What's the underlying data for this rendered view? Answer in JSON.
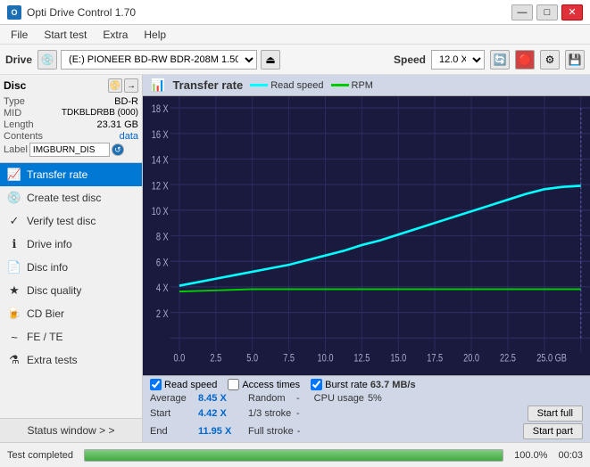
{
  "titleBar": {
    "title": "Opti Drive Control 1.70",
    "icon": "O",
    "minimizeLabel": "—",
    "maximizeLabel": "□",
    "closeLabel": "✕"
  },
  "menuBar": {
    "items": [
      "File",
      "Start test",
      "Extra",
      "Help"
    ]
  },
  "toolbar": {
    "driveLabel": "Drive",
    "driveValue": "(E:)  PIONEER BD-RW  BDR-208M 1.50",
    "speedLabel": "Speed",
    "speedValue": "12.0 X ↓"
  },
  "disc": {
    "title": "Disc",
    "typeKey": "Type",
    "typeVal": "BD-R",
    "midKey": "MID",
    "midVal": "TDKBLDRBB (000)",
    "lengthKey": "Length",
    "lengthVal": "23.31 GB",
    "contentsKey": "Contents",
    "contentsVal": "data",
    "labelKey": "Label",
    "labelVal": "IMGBURN_DIS"
  },
  "nav": {
    "items": [
      {
        "id": "transfer-rate",
        "label": "Transfer rate",
        "active": true
      },
      {
        "id": "create-test-disc",
        "label": "Create test disc",
        "active": false
      },
      {
        "id": "verify-test-disc",
        "label": "Verify test disc",
        "active": false
      },
      {
        "id": "drive-info",
        "label": "Drive info",
        "active": false
      },
      {
        "id": "disc-info",
        "label": "Disc info",
        "active": false
      },
      {
        "id": "disc-quality",
        "label": "Disc quality",
        "active": false
      },
      {
        "id": "cd-bier",
        "label": "CD Bier",
        "active": false
      },
      {
        "id": "fe-te",
        "label": "FE / TE",
        "active": false
      },
      {
        "id": "extra-tests",
        "label": "Extra tests",
        "active": false
      }
    ],
    "statusWindow": "Status window > >"
  },
  "chart": {
    "title": "Transfer rate",
    "iconLabel": "chart-icon",
    "legend": {
      "readSpeedLabel": "Read speed",
      "rpmLabel": "RPM"
    },
    "yAxisLabels": [
      "18 X",
      "16 X",
      "14 X",
      "12 X",
      "10 X",
      "8 X",
      "6 X",
      "4 X",
      "2 X"
    ],
    "xAxisLabels": [
      "0.0",
      "2.5",
      "5.0",
      "7.5",
      "10.0",
      "12.5",
      "15.0",
      "17.5",
      "20.0",
      "22.5",
      "25.0 GB"
    ],
    "checkboxes": {
      "readSpeed": {
        "label": "Read speed",
        "checked": true
      },
      "accessTimes": {
        "label": "Access times",
        "checked": false
      },
      "burstRate": {
        "label": "Burst rate",
        "checked": true,
        "value": "63.7 MB/s"
      }
    },
    "stats": {
      "averageKey": "Average",
      "averageVal": "8.45 X",
      "randomKey": "Random",
      "randomVal": "-",
      "cpuKey": "CPU usage",
      "cpuVal": "5%",
      "startKey": "Start",
      "startVal": "4.42 X",
      "strokeKey": "1/3 stroke",
      "strokeVal": "-",
      "startFullLabel": "Start full",
      "endKey": "End",
      "endVal": "11.95 X",
      "fullStrokeKey": "Full stroke",
      "fullStrokeVal": "-",
      "startPartLabel": "Start part"
    }
  },
  "statusBar": {
    "text": "Test completed",
    "progressPercent": 100,
    "progressLabel": "100.0%",
    "timeLabel": "00:03"
  }
}
